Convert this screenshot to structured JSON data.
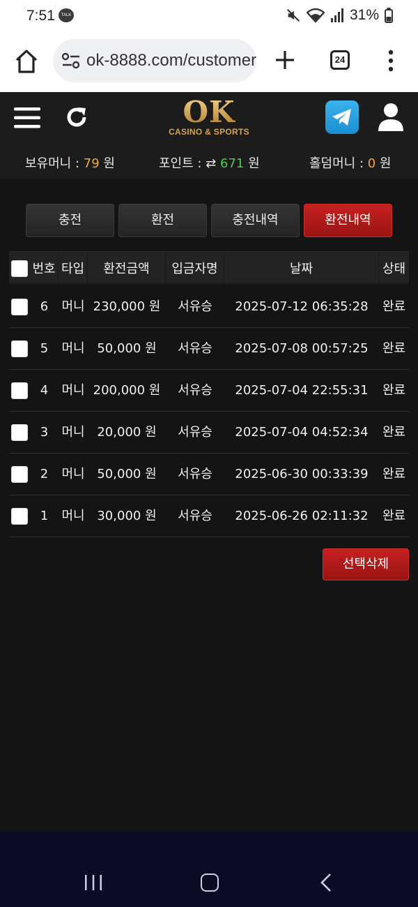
{
  "status_bar": {
    "time": "7:51",
    "talk_badge": "TALK",
    "battery": "31%"
  },
  "browser": {
    "url": "ok-8888.com/customer",
    "tab_count": "24"
  },
  "site": {
    "logo_main": "OK",
    "logo_sub": "CASINO & SPORTS",
    "balances": {
      "money_label": "보유머니 : ",
      "money_value": "79",
      "money_unit": " 원",
      "point_label": "포인트 : ",
      "point_icon": "⇄",
      "point_value": "671",
      "point_unit": " 원",
      "holdem_label": "홀덤머니 : ",
      "holdem_value": "0",
      "holdem_unit": " 원"
    }
  },
  "tabs": [
    {
      "label": "충전",
      "active": false
    },
    {
      "label": "환전",
      "active": false
    },
    {
      "label": "충전내역",
      "active": false
    },
    {
      "label": "환전내역",
      "active": true
    }
  ],
  "table": {
    "headers": [
      "번호",
      "타입",
      "환전금액",
      "입금자명",
      "날짜",
      "상태"
    ],
    "rows": [
      {
        "no": "6",
        "type": "머니",
        "amount": "230,000 원",
        "name": "서유승",
        "date": "2025-07-12 06:35:28",
        "status": "완료"
      },
      {
        "no": "5",
        "type": "머니",
        "amount": "50,000 원",
        "name": "서유승",
        "date": "2025-07-08 00:57:25",
        "status": "완료"
      },
      {
        "no": "4",
        "type": "머니",
        "amount": "200,000 원",
        "name": "서유승",
        "date": "2025-07-04 22:55:31",
        "status": "완료"
      },
      {
        "no": "3",
        "type": "머니",
        "amount": "20,000 원",
        "name": "서유승",
        "date": "2025-07-04 04:52:34",
        "status": "완료"
      },
      {
        "no": "2",
        "type": "머니",
        "amount": "50,000 원",
        "name": "서유승",
        "date": "2025-06-30 00:33:39",
        "status": "완료"
      },
      {
        "no": "1",
        "type": "머니",
        "amount": "30,000 원",
        "name": "서유승",
        "date": "2025-06-26 02:11:32",
        "status": "완료"
      }
    ]
  },
  "actions": {
    "delete_selected": "선택삭제"
  },
  "colors": {
    "accent_red": "#b31a1a",
    "money_orange": "#f0a830",
    "point_green": "#4cc94c",
    "logo_gold": "#d4a24a"
  }
}
